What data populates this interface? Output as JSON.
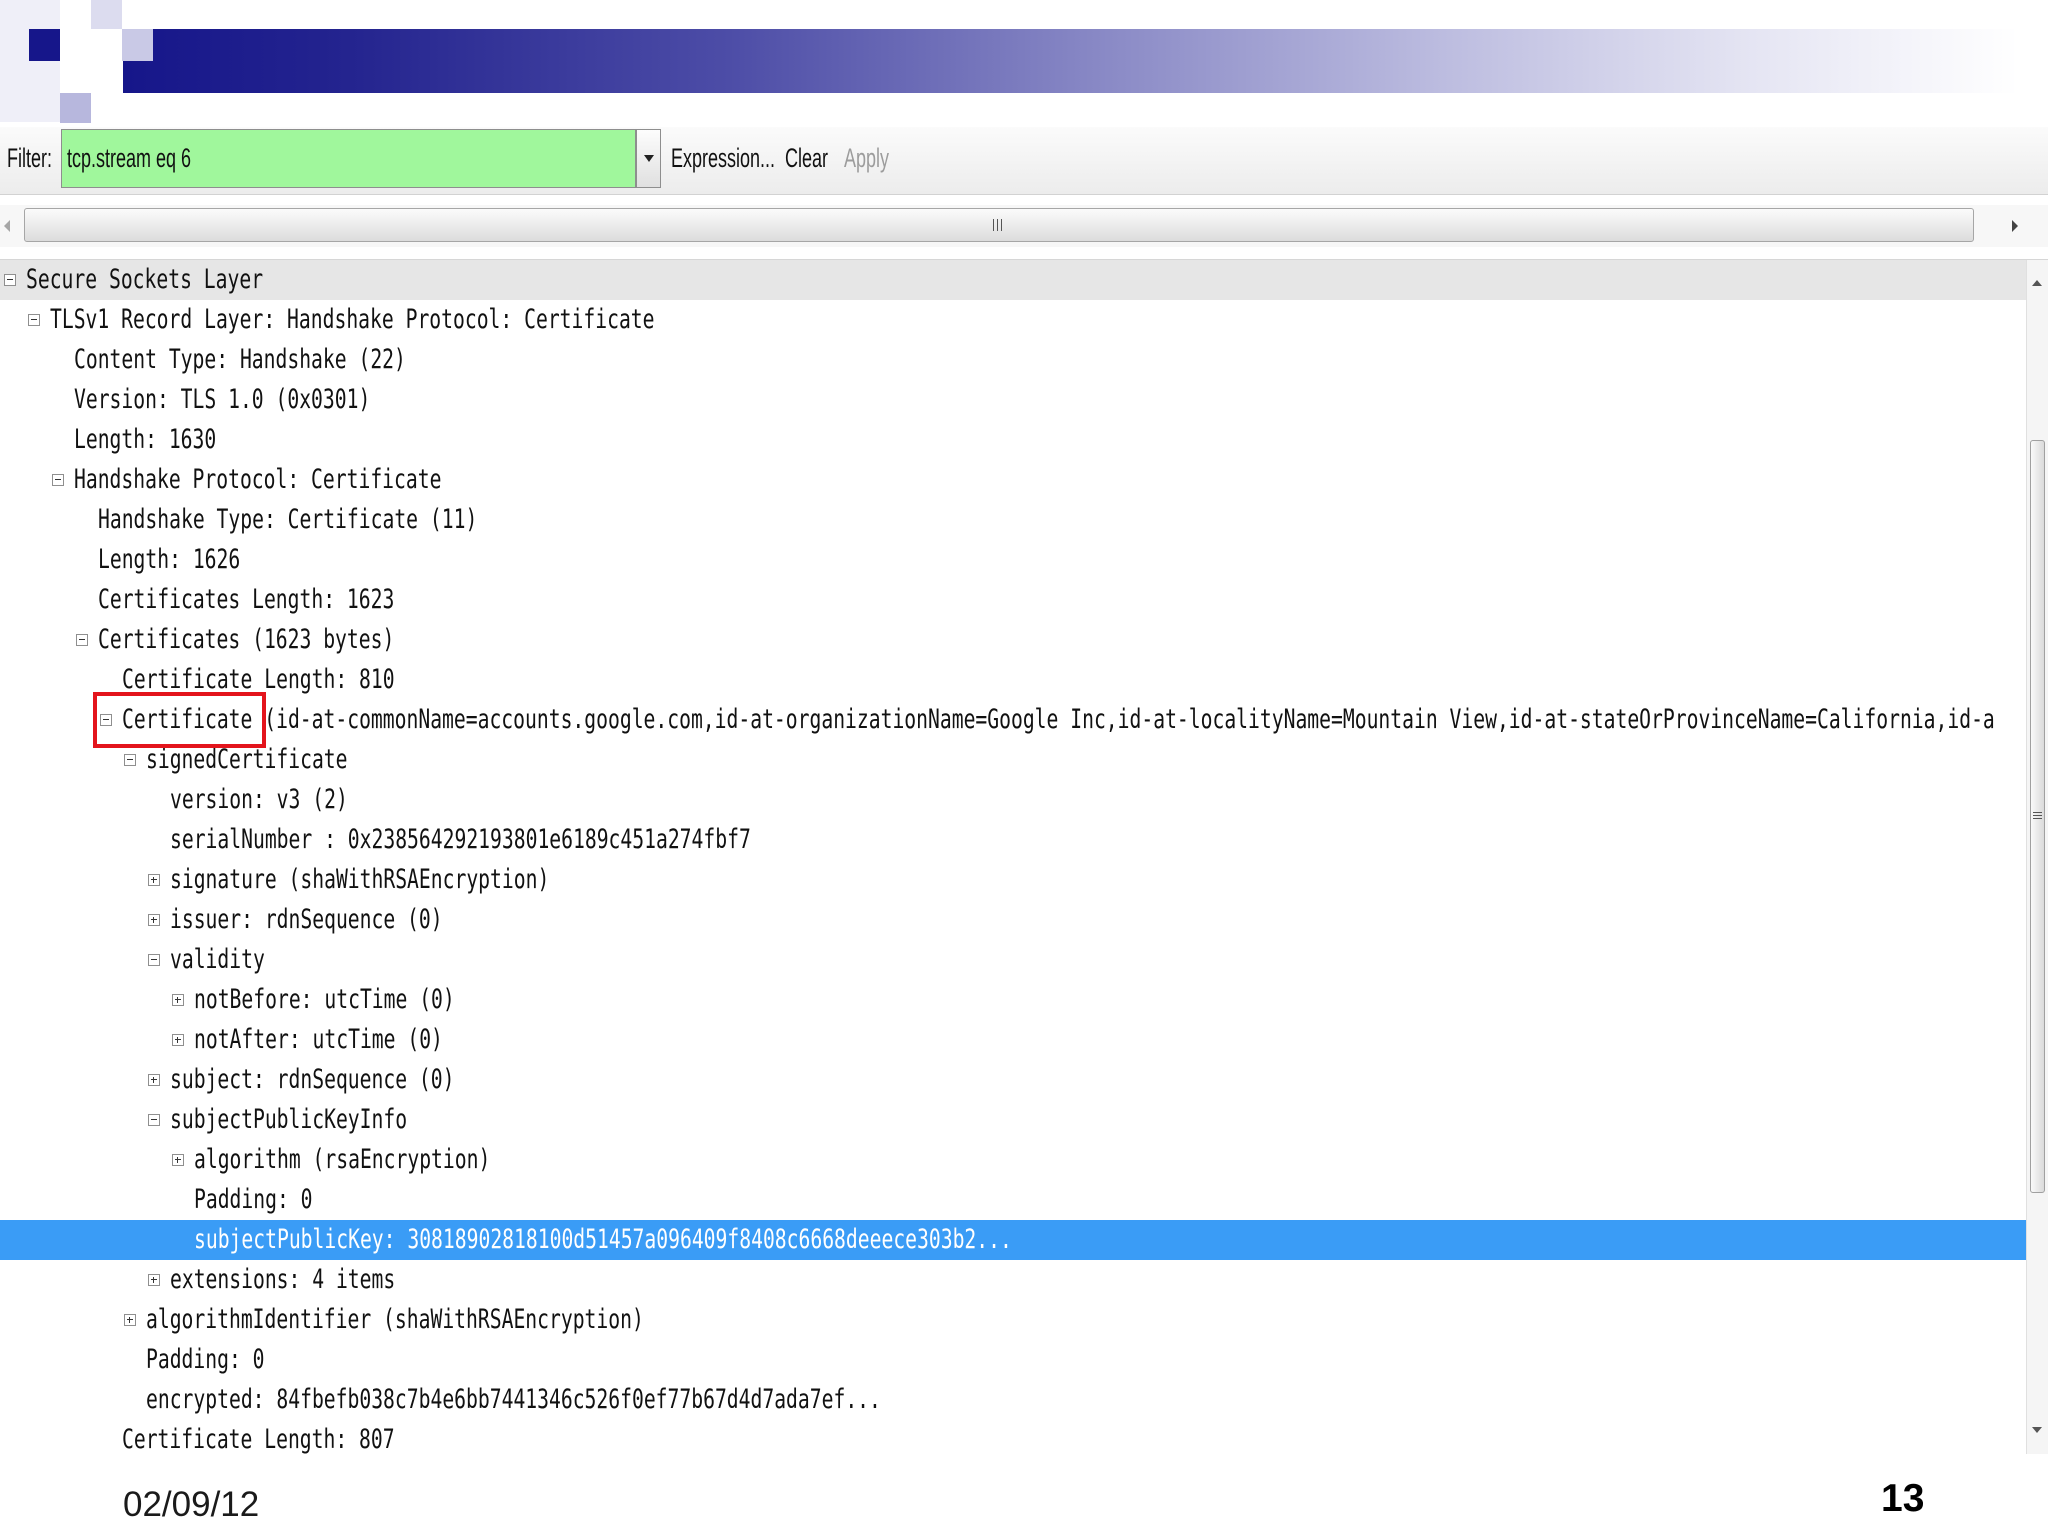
{
  "slide": {
    "date": "02/09/12",
    "page_number": "13"
  },
  "colors": {
    "title_bar": "#16168a",
    "filter_valid": "#a0f79c",
    "selection": "#3a9cf6",
    "annotation": "#e3141c"
  },
  "icons": {
    "filter_dropdown": "chevron-down-icon",
    "hscroll_left": "arrow-left-icon",
    "hscroll_right": "arrow-right-icon",
    "vscroll_up": "arrow-up-icon",
    "vscroll_down": "arrow-down-icon",
    "tree_expanded": "collapse-icon",
    "tree_collapsed": "expand-icon"
  },
  "filter_toolbar": {
    "label": "Filter:",
    "value": "tcp.stream eq 6",
    "buttons": [
      {
        "label": "Expression...",
        "enabled": true
      },
      {
        "label": "Clear",
        "enabled": true
      },
      {
        "label": "Apply",
        "enabled": false
      }
    ]
  },
  "packet_details": {
    "nodes": [
      {
        "label": "Secure Sockets Layer",
        "state": "expanded",
        "children": [
          {
            "label": "TLSv1 Record Layer: Handshake Protocol: Certificate",
            "state": "expanded",
            "children": [
              {
                "label": "Content Type: Handshake (22)"
              },
              {
                "label": "Version: TLS 1.0 (0x0301)"
              },
              {
                "label": "Length: 1630"
              },
              {
                "label": "Handshake Protocol: Certificate",
                "state": "expanded",
                "children": [
                  {
                    "label": "Handshake Type: Certificate (11)"
                  },
                  {
                    "label": "Length: 1626"
                  },
                  {
                    "label": "Certificates Length: 1623"
                  },
                  {
                    "label": "Certificates (1623 bytes)",
                    "state": "expanded",
                    "children": [
                      {
                        "label": "Certificate Length: 810"
                      },
                      {
                        "label": "Certificate",
                        "detail": "(id-at-commonName=accounts.google.com,id-at-organizationName=Google Inc,id-at-localityName=Mountain View,id-at-stateOrProvinceName=California,id-a",
                        "annotated": true,
                        "state": "expanded",
                        "children": [
                          {
                            "label": "signedCertificate",
                            "state": "expanded",
                            "children": [
                              {
                                "label": "version: v3 (2)"
                              },
                              {
                                "label": "serialNumber : 0x238564292193801e6189c451a274fbf7"
                              },
                              {
                                "label": "signature (shaWithRSAEncryption)",
                                "state": "collapsed"
                              },
                              {
                                "label": "issuer: rdnSequence (0)",
                                "state": "collapsed"
                              },
                              {
                                "label": "validity",
                                "state": "expanded",
                                "children": [
                                  {
                                    "label": "notBefore: utcTime (0)",
                                    "state": "collapsed"
                                  },
                                  {
                                    "label": "notAfter: utcTime (0)",
                                    "state": "collapsed"
                                  }
                                ]
                              },
                              {
                                "label": "subject: rdnSequence (0)",
                                "state": "collapsed"
                              },
                              {
                                "label": "subjectPublicKeyInfo",
                                "state": "expanded",
                                "children": [
                                  {
                                    "label": "algorithm (rsaEncryption)",
                                    "state": "collapsed"
                                  },
                                  {
                                    "label": "Padding: 0"
                                  },
                                  {
                                    "label": "subjectPublicKey: 30818902818100d51457a096409f8408c6668deeece303b2...",
                                    "selected": true
                                  }
                                ]
                              },
                              {
                                "label": "extensions: 4 items",
                                "state": "collapsed"
                              }
                            ]
                          },
                          {
                            "label": "algorithmIdentifier (shaWithRSAEncryption)",
                            "state": "collapsed"
                          },
                          {
                            "label": "Padding: 0"
                          },
                          {
                            "label": "encrypted: 84fbefb038c7b4e6bb7441346c526f0ef77b67d4d7ada7ef..."
                          }
                        ]
                      },
                      {
                        "label": "Certificate Length: 807"
                      }
                    ]
                  }
                ]
              }
            ]
          }
        ]
      }
    ]
  }
}
